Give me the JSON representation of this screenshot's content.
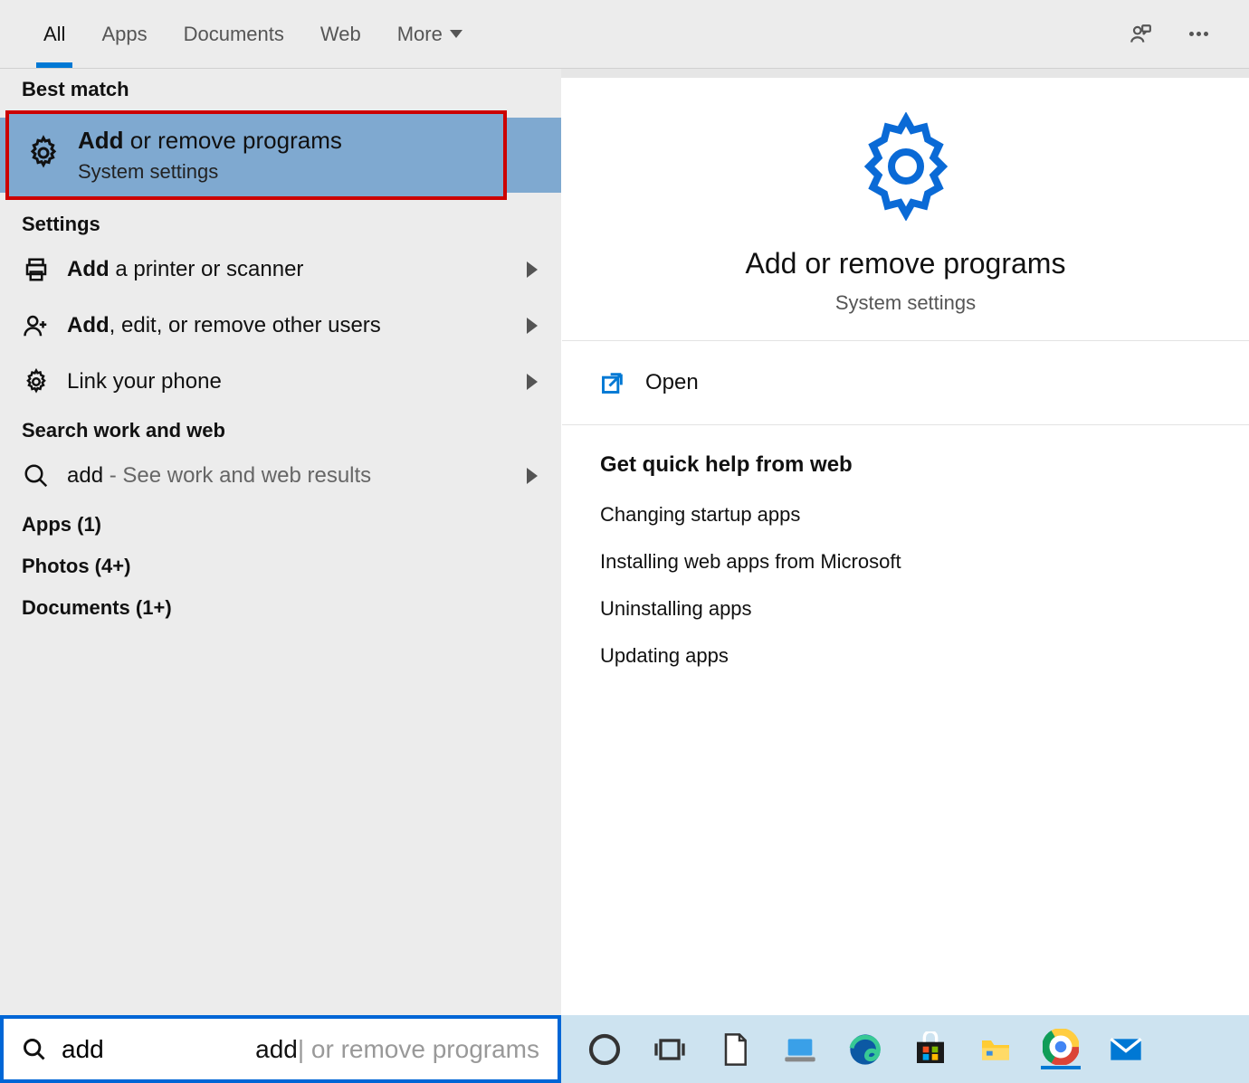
{
  "tabs": {
    "all": "All",
    "apps": "Apps",
    "documents": "Documents",
    "web": "Web",
    "more": "More"
  },
  "sections": {
    "best_match": "Best match",
    "settings": "Settings",
    "search_web": "Search work and web",
    "apps_count": "Apps (1)",
    "photos_count": "Photos (4+)",
    "docs_count": "Documents (1+)"
  },
  "best": {
    "title_bold": "Add",
    "title_rest": " or remove programs",
    "subtitle": "System settings"
  },
  "settings_rows": [
    {
      "bold": "Add",
      "rest": " a printer or scanner"
    },
    {
      "bold": "Add",
      "rest": ", edit, or remove other users"
    },
    {
      "bold": "",
      "rest": "Link your phone"
    }
  ],
  "web_row": {
    "bold": "add",
    "sub": " - See work and web results"
  },
  "preview": {
    "title": "Add or remove programs",
    "subtitle": "System settings",
    "open": "Open",
    "help_header": "Get quick help from web",
    "help_links": [
      "Changing startup apps",
      "Installing web apps from Microsoft",
      "Uninstalling apps",
      "Updating apps"
    ]
  },
  "search": {
    "value": "add",
    "placeholder": "add or remove programs"
  }
}
